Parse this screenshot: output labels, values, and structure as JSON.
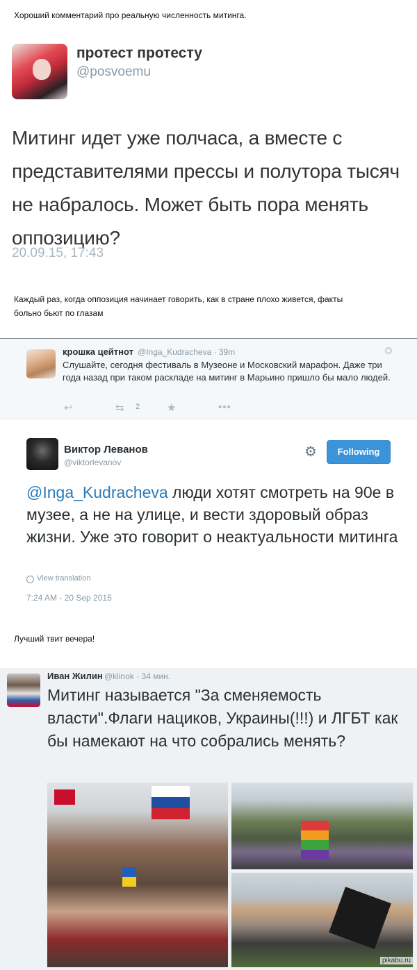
{
  "captions": {
    "first": "Хороший комментарий про реальную численность митинга.",
    "second_line1": "Каждый раз, когда оппозиция начинает говорить, как в стране плохо живется, факты",
    "second_line2": "больно бьют по глазам",
    "third": "Лучший твит вечера!"
  },
  "tweet1": {
    "name": "протест протесту",
    "handle": "@posvoemu",
    "text": "Митинг идет уже полчаса, а вместе с представителями прессы и полутора тысяч не набралось. Может быть пора менять оппозицию?",
    "time": "20.09.15, 17:43"
  },
  "tweet2": {
    "reply": {
      "name": "крошка цейтнот",
      "meta": "@Inga_Kudracheva · 39m",
      "text": "Слушайте, сегодня фестиваль в Музеоне и Московский марафон. Даже три года назад при таком раскладе на митинг в Марьино пришло бы мало людей.",
      "retweet_count": "2",
      "icons": [
        "reply-icon",
        "retweet-icon",
        "favorite-icon",
        "more-icon"
      ]
    },
    "name": "Виктор Леванов",
    "handle": "@viktorlevanov",
    "follow_label": "Following",
    "mention": "@Inga_Kudracheva",
    "text": " люди хотят смотреть на 90е в музее, а не на улице, и вести здоровый образ жизни. Уже это говорит о неактуальности митинга",
    "translate": "View translation",
    "time": "7:24 AM - 20 Sep 2015"
  },
  "tweet3": {
    "name": "Иван Жилин",
    "meta": "@klinok · 34 мин.",
    "text": "Митинг называется \"За сменяемость власти\".Флаги нациков, Украины(!!!) и ЛГБТ как бы намекают на что собрались менять?",
    "credit": "pikabu.ru"
  },
  "colors": {
    "link": "#2b7bb9",
    "follow_button": "#3b94d9",
    "muted": "#8899a6"
  }
}
